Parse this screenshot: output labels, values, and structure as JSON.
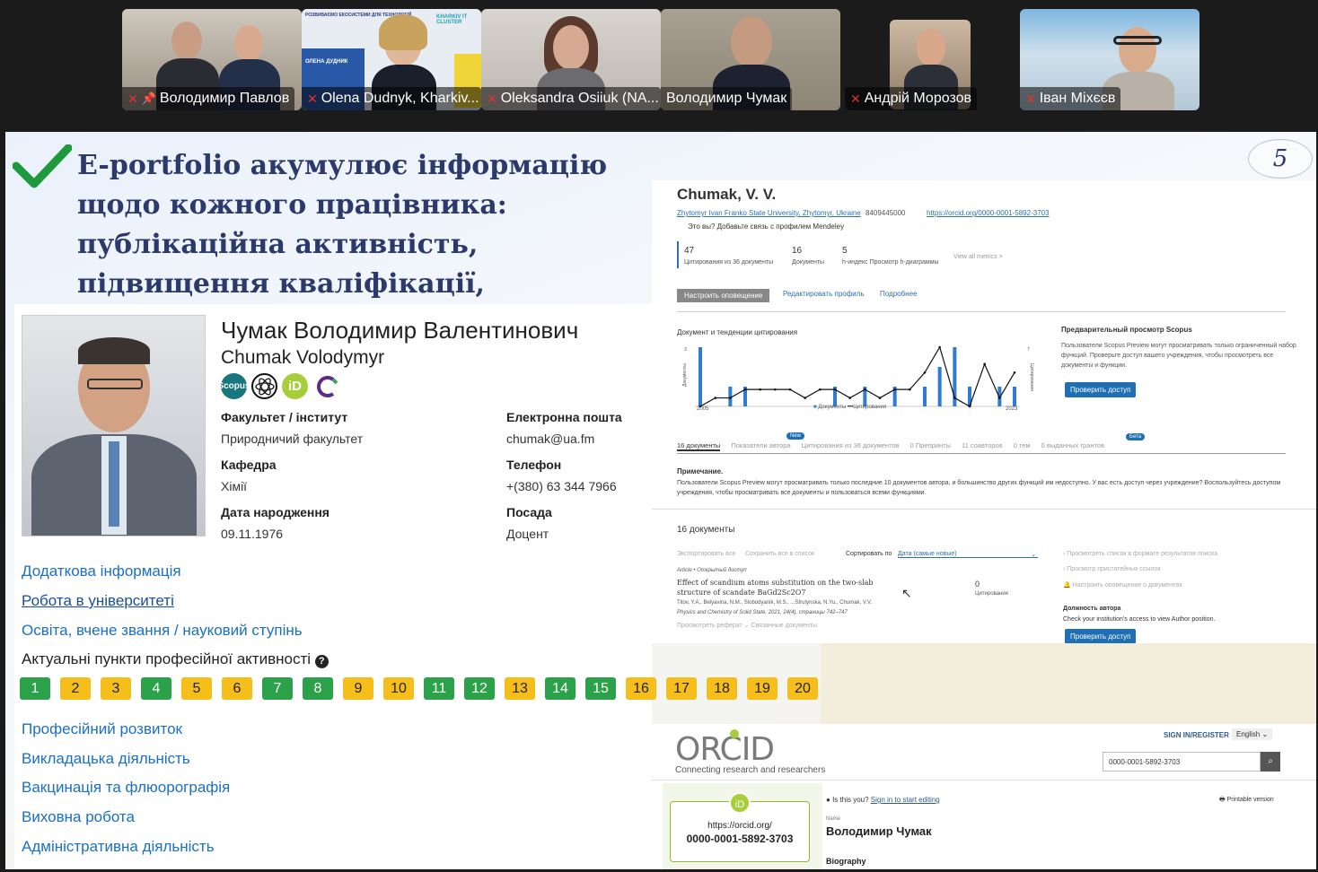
{
  "participants": [
    {
      "name": "Володимир Павлов",
      "muted": true,
      "pinned": true
    },
    {
      "name": "Olena Dudnyk, Kharkiv...",
      "muted": true
    },
    {
      "name": "Oleksandra Osiiuk (NA...",
      "muted": true
    },
    {
      "name": "Володимир Чумак",
      "muted": false,
      "active": true
    },
    {
      "name": "Андрій Морозов",
      "muted": true
    },
    {
      "name": "Іван Міхєєв",
      "muted": true
    }
  ],
  "tile2_banner": {
    "line1": "РОЗВИВАЄМО ЕКОСИСТЕМИ ДЛЯ ТЕХНОЛОГІЙ",
    "brand": "KHARKIV IT CLUSTER",
    "speaker": "ОЛЕНА ДУДНИК"
  },
  "slide": {
    "title": "E-portfolio акумулює інформацію щодо кожного працівника: публікаційна активність, підвищення кваліфікації, викладацька та інші види діяльності",
    "page_number": "5"
  },
  "profile": {
    "name_ua": "Чумак Володимир Валентинович",
    "name_en": "Chumak Volodymyr",
    "badges": [
      "Scopus",
      "",
      "iD",
      ""
    ],
    "fields": {
      "faculty_label": "Факультет / інститут",
      "faculty": "Природничий факультет",
      "email_label": "Електронна пошта",
      "email": "chumak@ua.fm",
      "dept_label": "Кафедра",
      "dept": "Хімії",
      "phone_label": "Телефон",
      "phone": "+(380) 63 344 7966",
      "dob_label": "Дата народження",
      "dob": "09.11.1976",
      "position_label": "Посада",
      "position": "Доцент"
    },
    "links_top": [
      "Додаткова інформація",
      "Робота в університеті",
      "Освіта, вчене звання / науковий ступінь"
    ],
    "activity_title": "Актуальні пункти професійної активності",
    "activity_items": [
      {
        "n": "1",
        "c": "g"
      },
      {
        "n": "2",
        "c": "y"
      },
      {
        "n": "3",
        "c": "y"
      },
      {
        "n": "4",
        "c": "g"
      },
      {
        "n": "5",
        "c": "y"
      },
      {
        "n": "6",
        "c": "y"
      },
      {
        "n": "7",
        "c": "g"
      },
      {
        "n": "8",
        "c": "g"
      },
      {
        "n": "9",
        "c": "y"
      },
      {
        "n": "10",
        "c": "y"
      },
      {
        "n": "11",
        "c": "g"
      },
      {
        "n": "12",
        "c": "g"
      },
      {
        "n": "13",
        "c": "y"
      },
      {
        "n": "14",
        "c": "g"
      },
      {
        "n": "15",
        "c": "g"
      },
      {
        "n": "16",
        "c": "y"
      },
      {
        "n": "17",
        "c": "y"
      },
      {
        "n": "18",
        "c": "y"
      },
      {
        "n": "19",
        "c": "y"
      },
      {
        "n": "20",
        "c": "y"
      }
    ],
    "links_bottom": [
      "Професійний розвиток",
      "Викладацька діяльність",
      "Вакцинація та флюорографія",
      "Виховна робота",
      "Адміністративна діяльність"
    ]
  },
  "scopus": {
    "author": "Chumak, V. V.",
    "affiliation": "Zhytomyr Ivan Franko State University, Zhytomyr, Ukraine",
    "author_id": "8409445000",
    "orcid_link": "https://orcid.org/0000-0001-5892-3703",
    "mendeley": "Это вы? Добавьте связь с профилем Mendeley",
    "metrics": [
      {
        "value": "47",
        "label": "Цитирования из 36 документы"
      },
      {
        "value": "16",
        "label": "Документы"
      },
      {
        "value": "5",
        "label": "h-индекс Просмотр h-диаграммы"
      }
    ],
    "view_all": "View all metrics >",
    "btn_alert": "Настроить оповещение",
    "btn_edit": "Редактировать профиль",
    "btn_more": "Подробнее",
    "chart_title": "Документ и тенденции цитирования",
    "chart_axis_left": "Документы",
    "chart_axis_right": "Цитирования",
    "chart_x_start": "2005",
    "chart_x_end": "2023",
    "legend_docs": "Документы",
    "legend_cit": "Цитирования",
    "preview_title": "Предварительный просмотр Scopus",
    "preview_text": "Пользователи Scopus Preview могут просматривать только ограниченный набор функций. Проверьте доступ вашего учреждения, чтобы просмотреть все документы и функции.",
    "check_access": "Проверить доступ",
    "tabs": [
      "16 документы",
      "Показатели автора",
      "Цитирования из 36 документов",
      "0 Препринты",
      "11 соавторов",
      "0 тем",
      "0 выданных грантов"
    ],
    "tab_new": "New",
    "tab_beta": "Бета",
    "note_title": "Примечание.",
    "note_text": "Пользователи Scopus Preview могут просматривать только последние 10 документов автора, и большинство других функций им недоступно. У вас есть доступ через учреждение? Воспользуйтесь доступом учреждения, чтобы просматривать все документы и пользоваться всеми функциями.",
    "docs_heading": "16 документы",
    "export_all": "Экспортировать все",
    "save_all": "Сохранить все в список",
    "sort_label": "Сортировать по",
    "sort_value": "Дата (самые новые)",
    "side_links": [
      "Просмотреть список в формате результатов поиска",
      "Просмотр пристатейных ссылок",
      "Настроить оповещение о документах"
    ],
    "doc_type": "Article • Открытый доступ",
    "doc_title": "Effect of scandium atoms substitution on the two-slab structure of scandate BaGd2Sc2O7",
    "doc_authors": "Titov, Y.A., Belyavina, N.M., Slobodyanik, M.S., ...Strutynska, N.Yu., Chumak, V.V.",
    "doc_journal": "Physics and Chemistry of Solid State, 2021, 24(4), страницы 742–747",
    "doc_links": "Просмотреть реферат ⌄   Связанные документы",
    "doc_citations": "0",
    "doc_citations_label": "Цитирования",
    "author_pos_title": "Должность автора",
    "author_pos_text": "Check your institution's access to view Author position.",
    "check_access2": "Проверить доступ"
  },
  "chart_data": {
    "type": "bar",
    "x_start": "2005",
    "x_end": "2023",
    "y_left_max": 3,
    "y_right_max": 7,
    "series": [
      {
        "name": "Документы",
        "values": [
          3,
          0,
          1,
          1,
          0,
          0,
          0,
          0,
          0,
          1,
          0,
          1,
          0,
          1,
          0,
          1,
          2,
          3,
          1,
          0,
          1,
          1
        ]
      },
      {
        "name": "Цитирования",
        "values": [
          0,
          1,
          1,
          2,
          2,
          2,
          2,
          1,
          2,
          2,
          1,
          2,
          1,
          2,
          2,
          4,
          7,
          1,
          0,
          5,
          1,
          4
        ]
      }
    ]
  },
  "orcid": {
    "logo": "ORCID",
    "tagline": "Connecting research and researchers",
    "sign_in": "SIGN IN/REGISTER",
    "lang": "English",
    "search_value": "0000-0001-5892-3703",
    "is_this_you": "Is this you?",
    "sign_in_edit": "Sign in to start editing",
    "printable": "Printable version",
    "id_url": "https://orcid.org/",
    "id_value": "0000-0001-5892-3703",
    "name_label": "Name",
    "name": "Володимир Чумак",
    "biography_label": "Biography"
  },
  "colors": {
    "active_speaker": "#2fd07a",
    "link": "#1a6fc7",
    "green_badge": "#2ba24a",
    "yellow_badge": "#f5be1a",
    "scopus_btn": "#1f6fb5",
    "orcid_green": "#a6ce39"
  }
}
